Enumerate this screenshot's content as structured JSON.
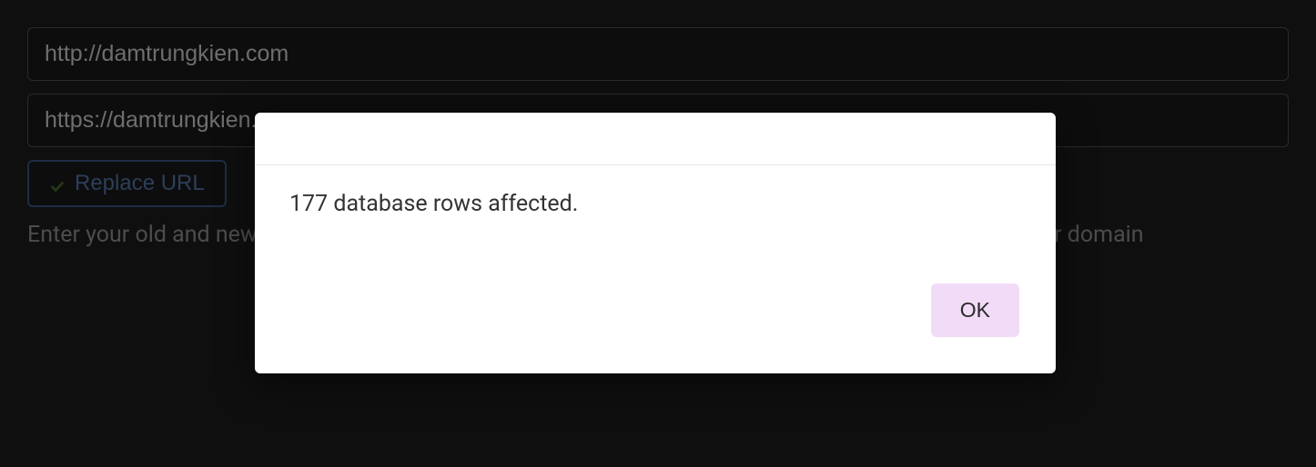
{
  "form": {
    "old_url": "http://damtrungkien.com",
    "new_url": "https://damtrungkien.com",
    "replace_button_label": "Replace URL",
    "description": "Enter your old and new URLs for your WordPress installation, to update all Elementor data (Relevant for domain"
  },
  "dialog": {
    "message": "177 database rows affected.",
    "ok_label": "OK"
  }
}
